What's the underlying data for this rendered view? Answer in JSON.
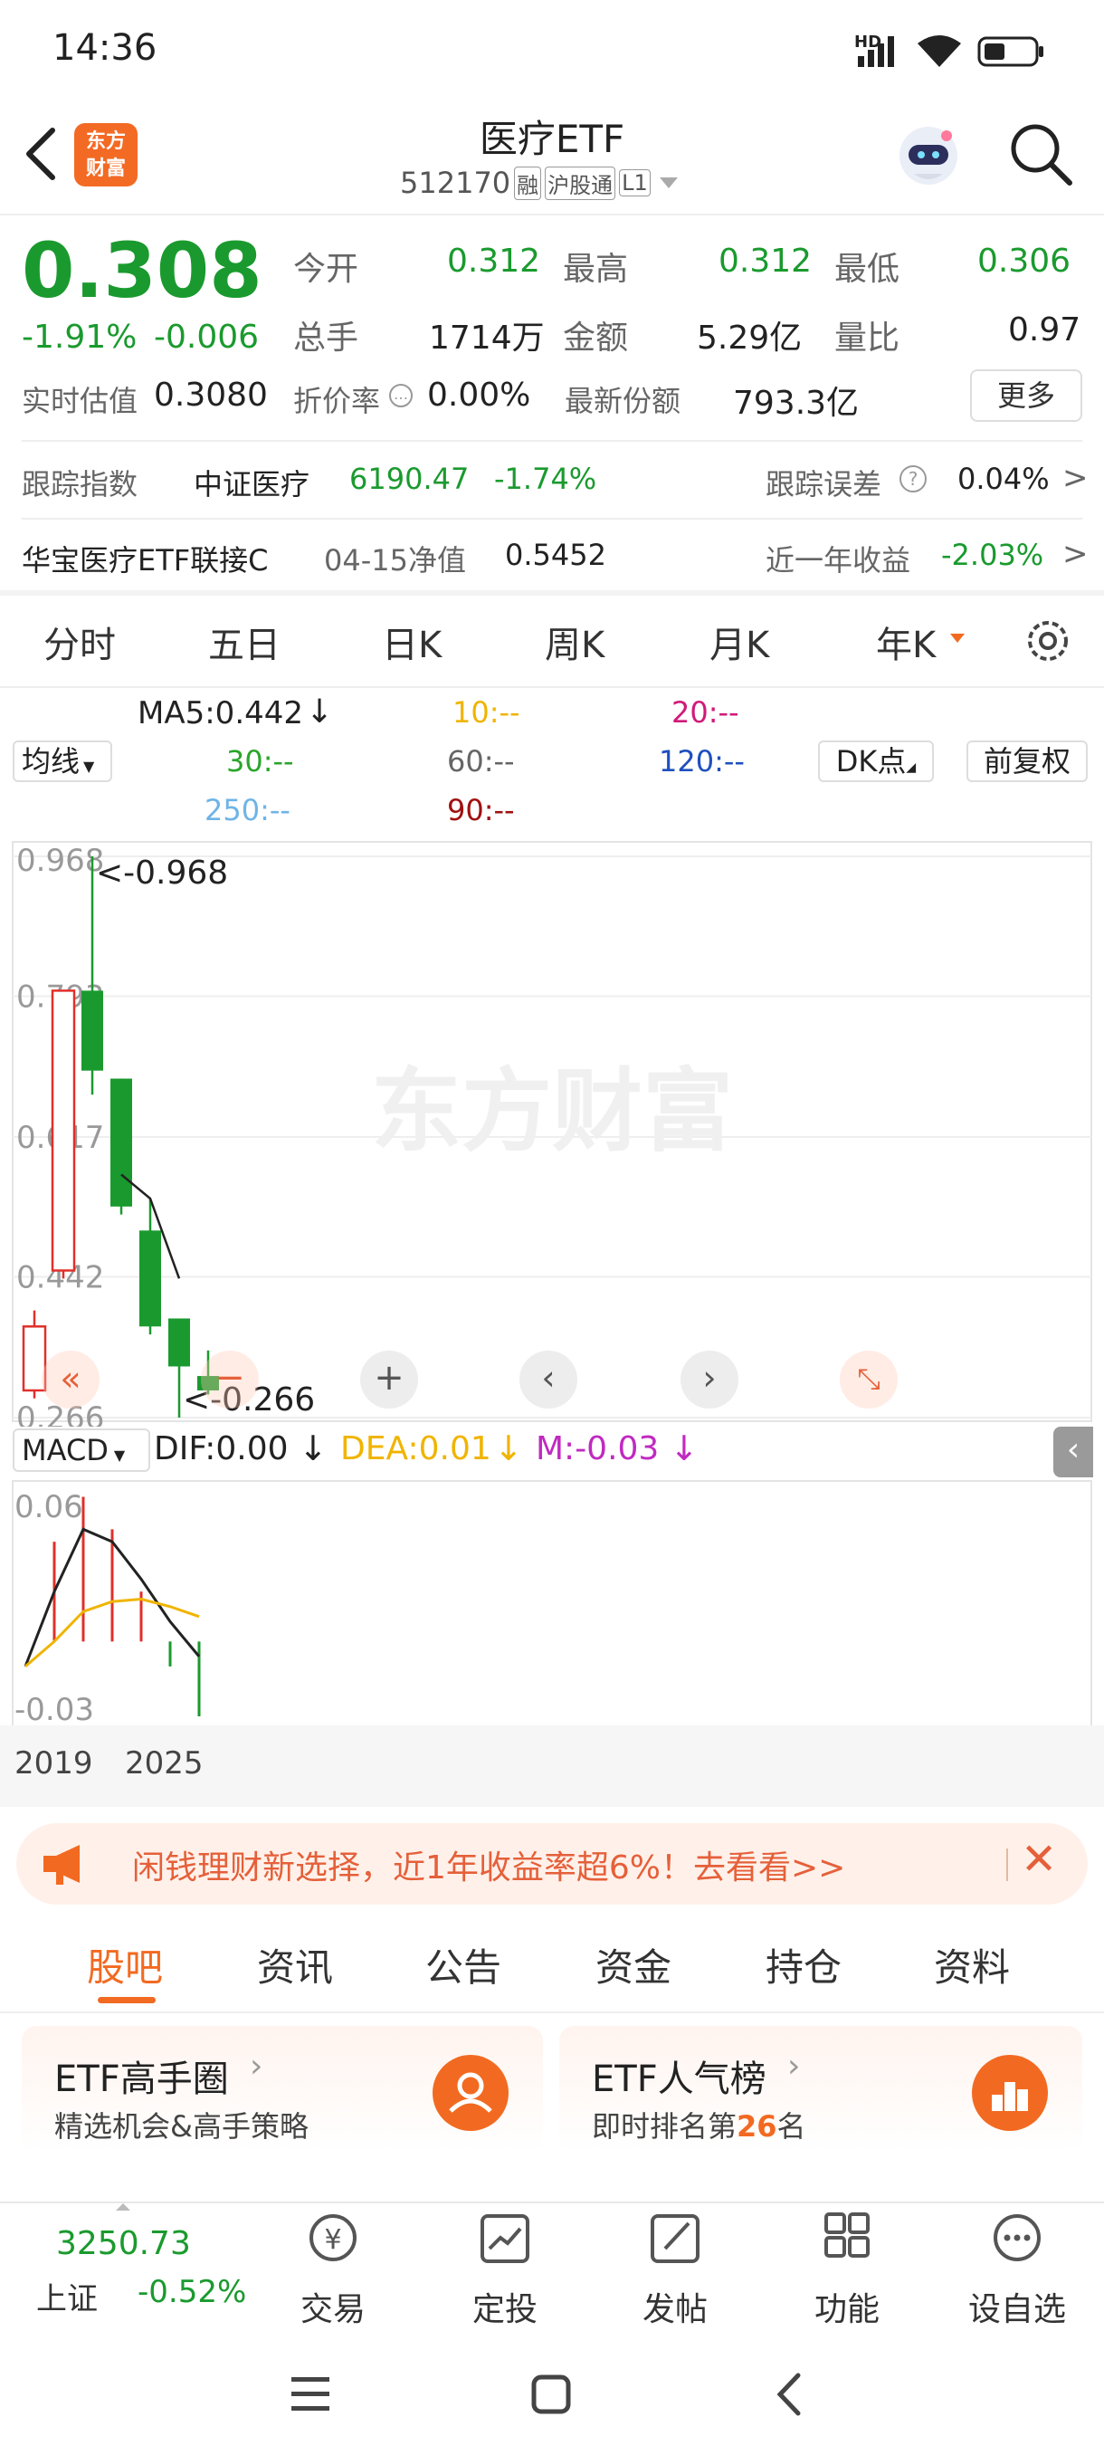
{
  "status_bar": {
    "time": "14:36",
    "network": "HD"
  },
  "header": {
    "title": "医疗ETF",
    "code": "512170",
    "tags": [
      "融",
      "沪股通",
      "L1"
    ],
    "logo_text": "东方财富"
  },
  "quote": {
    "price": "0.308",
    "change_pct": "-1.91%",
    "change": "-0.006",
    "fields": [
      {
        "label": "今开",
        "value": "0.312"
      },
      {
        "label": "最高",
        "value": "0.312"
      },
      {
        "label": "最低",
        "value": "0.306"
      },
      {
        "label": "总手",
        "value": "1714万"
      },
      {
        "label": "金额",
        "value": "5.29亿"
      },
      {
        "label": "量比",
        "value": "0.97"
      }
    ],
    "est_label": "实时估值",
    "est_value": "0.3080",
    "discount_label": "折价率",
    "discount_value": "0.00%",
    "shares_label": "最新份额",
    "shares_value": "793.3亿",
    "more_button": "更多"
  },
  "tracking": {
    "label": "跟踪指数",
    "index_name": "中证医疗",
    "index_value": "6190.47",
    "index_change": "-1.74%",
    "error_label": "跟踪误差",
    "error_value": "0.04%"
  },
  "fund": {
    "name": "华宝医疗ETF联接C",
    "nav_label": "04-15净值",
    "nav_value": "0.5452",
    "return_label": "近一年收益",
    "return_value": "-2.03%"
  },
  "period_tabs": [
    "分时",
    "五日",
    "日K",
    "周K",
    "月K",
    "年K"
  ],
  "active_period": "年K",
  "indicators": {
    "avg_button": "均线",
    "ma5": "MA5:0.442",
    "ma10": "10:--",
    "ma20": "20:--",
    "ma30": "30:--",
    "ma60": "60:--",
    "ma120": "120:--",
    "ma250": "250:--",
    "ma90": "90:--",
    "dk_button": "DK点",
    "adjust_button": "前复权",
    "colors": {
      "ma5": "#222222",
      "ma10": "#f0b400",
      "ma20": "#d01a7a",
      "ma30": "#2aa52a",
      "ma60": "#666666",
      "ma120": "#1f4fbf",
      "ma250": "#6fb4e6",
      "ma90": "#a01010"
    }
  },
  "chart_data": {
    "type": "candlestick",
    "price_ticks": [
      "0.968",
      "0.793",
      "0.617",
      "0.442",
      "0.266"
    ],
    "ylim": [
      0.266,
      0.968
    ],
    "high_label": "<-0.968",
    "low_label": "<-0.266",
    "candles": [
      {
        "open": 0.3,
        "close": 0.38,
        "high": 0.4,
        "low": 0.29,
        "dir": "up"
      },
      {
        "open": 0.45,
        "close": 0.8,
        "high": 0.8,
        "low": 0.44,
        "dir": "up"
      },
      {
        "open": 0.8,
        "close": 0.7,
        "high": 0.968,
        "low": 0.67,
        "dir": "down"
      },
      {
        "open": 0.69,
        "close": 0.53,
        "high": 0.69,
        "low": 0.52,
        "dir": "down"
      },
      {
        "open": 0.5,
        "close": 0.38,
        "high": 0.54,
        "low": 0.37,
        "dir": "down"
      },
      {
        "open": 0.39,
        "close": 0.33,
        "high": 0.39,
        "low": 0.266,
        "dir": "down"
      },
      {
        "open": 0.318,
        "close": 0.3,
        "high": 0.35,
        "low": 0.295,
        "dir": "down"
      }
    ],
    "ma5_line": [
      0.57,
      0.54,
      0.44
    ],
    "macd": {
      "label": "MACD",
      "dif": "DIF:0.00",
      "dea": "DEA:0.01",
      "m": "M:-0.03",
      "ticks": [
        "0.06",
        "-0.03"
      ],
      "ylim": [
        -0.03,
        0.06
      ],
      "dif_line": [
        -0.01,
        0.02,
        0.045,
        0.04,
        0.025,
        0.008,
        -0.006
      ],
      "dea_line": [
        -0.01,
        0.0,
        0.012,
        0.016,
        0.017,
        0.014,
        0.01
      ],
      "hist": [
        0.0,
        0.04,
        0.058,
        0.045,
        0.02,
        -0.01,
        -0.03
      ]
    },
    "x_labels": [
      "2019",
      "2025"
    ]
  },
  "banner": {
    "text": "闲钱理财新选择，近1年收益率超6%！去看看>>"
  },
  "news_tabs": [
    "股吧",
    "资讯",
    "公告",
    "资金",
    "持仓",
    "资料"
  ],
  "active_news_tab": "股吧",
  "cards": [
    {
      "title": "ETF高手圈",
      "subtitle": "精选机会&高手策略"
    },
    {
      "title": "ETF人气榜",
      "subtitle_prefix": "即时排名第",
      "rank": "26",
      "subtitle_suffix": "名"
    }
  ],
  "bottom_bar": {
    "index_value": "3250.73",
    "index_name": "上证",
    "index_change": "-0.52%",
    "items": [
      "交易",
      "定投",
      "发帖",
      "功能",
      "设自选"
    ]
  },
  "watermark": "东方财富"
}
